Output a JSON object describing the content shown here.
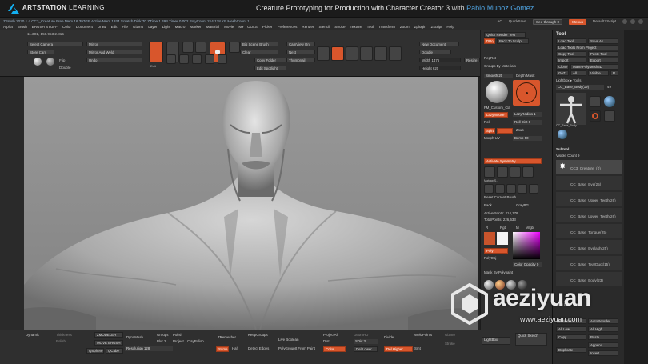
{
  "banner": {
    "brand_prefix": "ART",
    "brand_mid": "STATION",
    "brand_suffix": "LEARNING",
    "course_title": "Creature Prototyping for Production with Character Creator 3",
    "with": "with",
    "instructor": "Pablo Munoz Gomez"
  },
  "menubar": {
    "status": "ZBrush 2020.1.4    CC3_Creature    Free Mem 16.397GB    Active Mem 1934    Scratch Disk 70    ZTime 1.494 Timer 0.002    PolyCount 214.178 KP    MeshCount 1",
    "menus": [
      "Alpha",
      "Brush",
      "BRUSH STUFF",
      "Color",
      "Document",
      "Draw",
      "Edit",
      "File",
      "Gizmo",
      "Layer",
      "Light",
      "Macro",
      "Marker",
      "Material",
      "Movie",
      "MY TOOLS",
      "Picker",
      "Preferences",
      "Render",
      "Stencil",
      "Stroke",
      "Texture",
      "Tool",
      "Transform",
      "Zoom",
      "Zplugin",
      "Zscript",
      "Help"
    ],
    "ac": "AC",
    "quicksave": "QuickSave",
    "see_through": "See-through 0",
    "menus_label": "Menus",
    "script": "DefaultZScript"
  },
  "toolbar": {
    "coords": "11.301,-150.953,2.815",
    "select_camera": "Select Camera",
    "store_cam": "Store Cam",
    "flip": "Flip",
    "double": "Double",
    "mirror": "Mirror",
    "mirror_weld": "Mirror And Weld",
    "undo": "Undo",
    "icons": [
      "Edit",
      "Draw",
      "Move",
      "Scale",
      "Rotate",
      "Mrgb",
      "Rgb",
      "M",
      "Zadd",
      "Zsub",
      "Zcut",
      "Focal Shift 0",
      "Draw Size 64",
      "Dynamic",
      "Rgb Intensity 100",
      "Z Intensity 25"
    ],
    "big_scene_brush": "Big Scene Brush",
    "clear": "Clear",
    "copy_folder": "Copy Folder",
    "thumbnail": "Thumbnail",
    "edit_spotlight": "Edit Spotlight",
    "live_boolean": "Live Boolean",
    "next": "Next",
    "lightbox": "LightBox",
    "camview": "CamView On",
    "new_document": "New Document",
    "doodle": "Doodle",
    "width": "Width 1476",
    "height": "Height 620",
    "resize": "Resize",
    "quick_render": "Quick Render Test",
    "dpa_to": "DPo_1",
    "back_to_sculpt": "Back To Sculpt"
  },
  "panel": {
    "repeat": "RepRot",
    "groups_by_materials": "Groups By Materials",
    "smooth": "Smooth 20",
    "depth_mask": "Depth Mask",
    "matcap_left": "FM_Custom_Cla",
    "matcap_right": "Lazy Mouse",
    "lazymouse": "LazyMouse",
    "lazyradius": "LazyRadius 1",
    "roll": "Roll",
    "roll_dist": "Roll Dist 6",
    "spiral": "Spiral",
    "zsub": "Zsub",
    "mesh_uv": "Morph UV",
    "bump": "Bump 50",
    "activate_symmetry": "Activate Symmetry",
    "brushes": [
      "Matcap S...",
      "Inflat...",
      "SelectR...",
      "SelectL..."
    ],
    "brush_row2": [
      "XTrackI...",
      "XTrack...",
      "History...",
      "MPoll...",
      "Curve..."
    ],
    "reset_current": "Reset Current Brush",
    "back": "Back",
    "gray_bg": "GrayBG",
    "active_points": "ActivePoints: 214,178",
    "total_points": "TotalPoints: 226,633",
    "r": "R",
    "m": "M",
    "mrgb": "Mrgb",
    "rgb": "Rgb",
    "poly": "Poly",
    "polyobj": "PolyObj",
    "color_opacity": "Color Opacity 0",
    "mask_by_polypaint": "Mask By Polypaint"
  },
  "tool": {
    "header": "Tool",
    "load_tool": "Load Tool",
    "save_as": "Save As",
    "load_from_project": "Load Tools From Project",
    "copy_tool": "Copy Tool",
    "paste_tool": "Paste Tool",
    "import": "Import",
    "export": "Export",
    "clone": "Clone",
    "make_polymesh": "Make PolyMesh3D",
    "goz": "GoZ",
    "all": "All",
    "visible": "Visible",
    "r": "R",
    "lightbox_tools": "Lightbox ▸ Tools",
    "current_tool": "CC_Base_Body(19)",
    "count": "49",
    "thumbs": [
      "CC_Base_Body",
      "AlphaBr",
      "Cylinder3D",
      "SimpleBrush",
      "EraserB",
      "Pm3D"
    ],
    "subtool_header": "Subtool",
    "visible_count": "Visible Count 9",
    "subtools": [
      "CC3_Creature_(0)",
      "CC_Base_Eye(25)",
      "CC_Base_Upper_Teeth(26)",
      "CC_Base_Lower_Teeth(26)",
      "CC_Base_Tongue(25)",
      "CC_Base_Eyelash(25)",
      "CC_Base_TearDuct(15)",
      "CC_Base_Body(23)"
    ],
    "new_list": "New List",
    "rename": "Rename",
    "autoreorder": "AutoReorder",
    "all_low": "All Low",
    "all_high": "All High",
    "copy": "Copy",
    "paste": "Paste",
    "append": "Append",
    "duplicate": "Duplicate",
    "insert": "Insert"
  },
  "bottom": {
    "dynamic": "Dynamic",
    "thickness": "Thickness",
    "polish": "Polish",
    "zmodeler": "ZMODELER",
    "move_brush": "MOVE BRUSH",
    "qsphere": "QSphere",
    "qcube": "QCube",
    "dynamesh": "DynaMesh",
    "groups": "Groups",
    "polish2": "Polish",
    "blur": "Blur 2",
    "project": "Project",
    "resolution": "Resolution 128",
    "claypolish": "ClayPolish",
    "zremesher": "ZRemesher",
    "keepgroups": "KeepGroups",
    "half": "Half",
    "same": "Same",
    "detect_edges": "Detect Edges",
    "live_boolean": "Live Boolean",
    "polygroupit": "PolyGroupIt From Paint",
    "project_all": "ProjectAll",
    "dist": "Dist",
    "zdivide": "SDiv 3",
    "del_lower": "Del Lower",
    "del_higher": "Del Higher",
    "divide": "Divide",
    "smt": "Smt",
    "stroke": "Stroke",
    "color": "Color",
    "geomhd": "GeomHD",
    "weld_points": "WeldPoints",
    "gizmo": "Gizmo",
    "lightbox": "LightBox",
    "quick_sketch": "Quick Sketch"
  },
  "watermark": {
    "text": "aeziyuan",
    "url": "www.aeziyuan.com"
  }
}
